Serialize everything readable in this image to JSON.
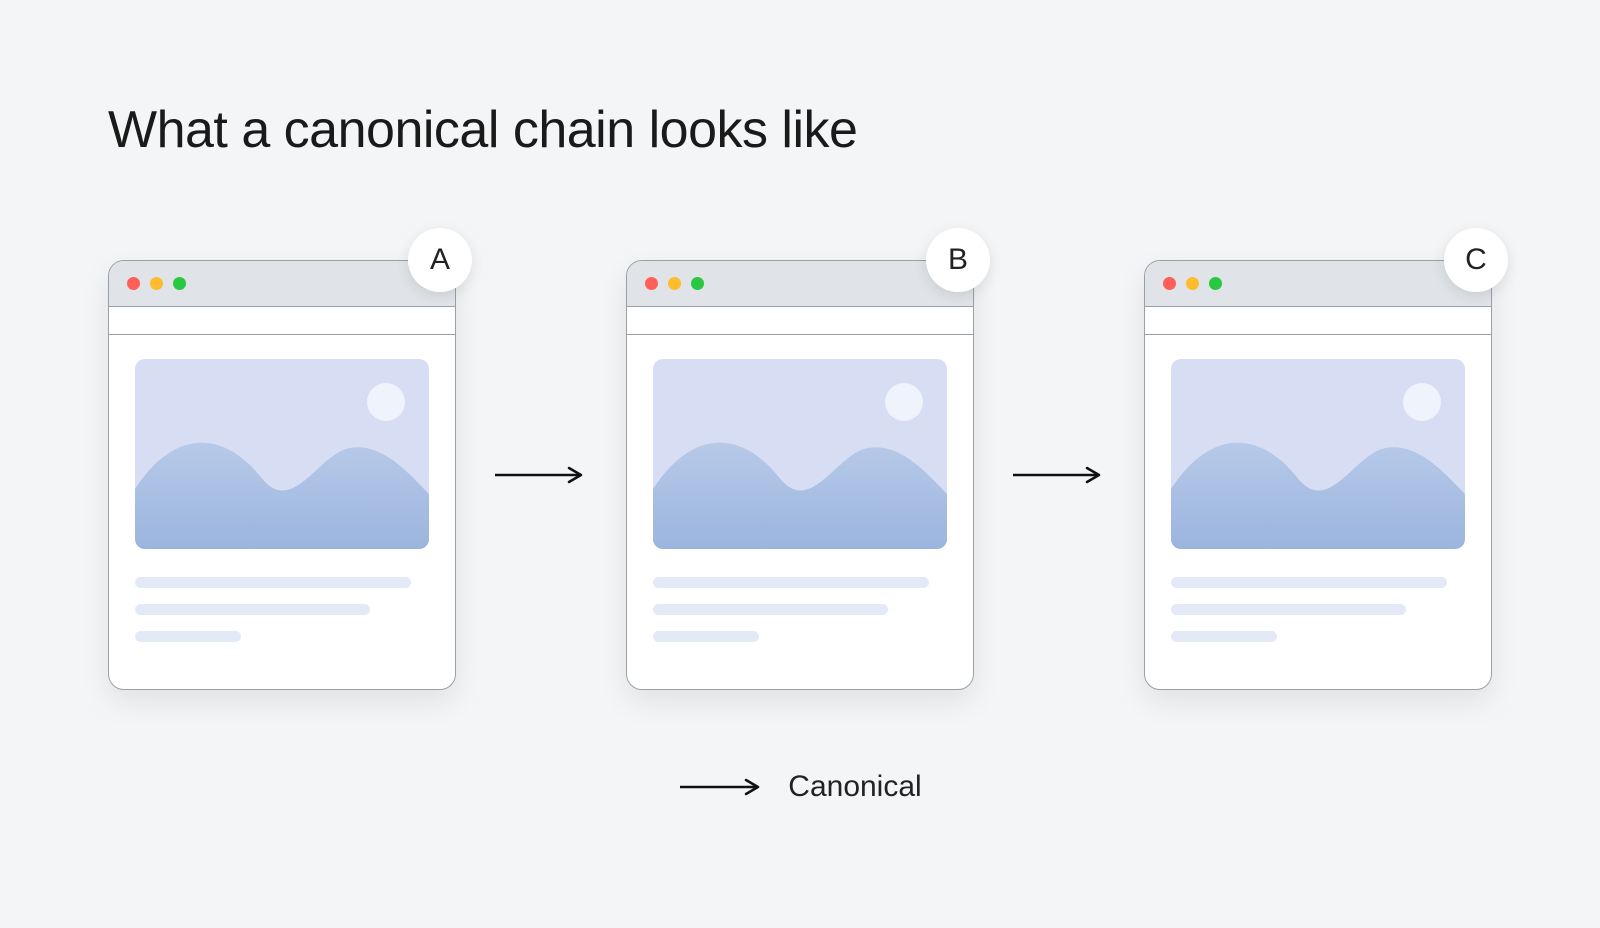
{
  "title": "What a canonical chain looks like",
  "cards": [
    {
      "label": "A"
    },
    {
      "label": "B"
    },
    {
      "label": "C"
    }
  ],
  "legend": {
    "label": "Canonical"
  },
  "icons": {
    "arrow": "arrow-right-icon",
    "traffic_red": "close-dot",
    "traffic_yellow": "minimize-dot",
    "traffic_green": "zoom-dot"
  }
}
